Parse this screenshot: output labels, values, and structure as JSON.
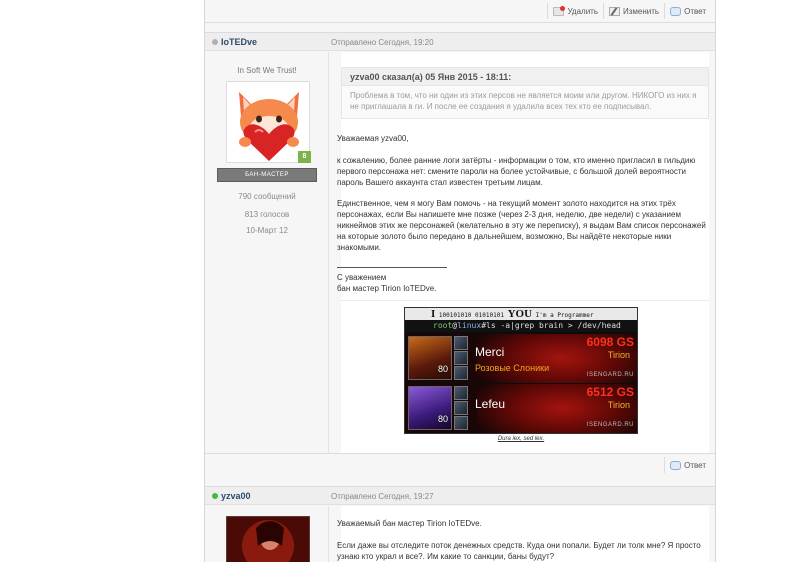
{
  "top_actions": {
    "delete_label": "Удалить",
    "edit_label": "Изменить",
    "reply_label": "Ответ"
  },
  "post1": {
    "author": "IoTEDve",
    "date": "Отправлено Сегодня, 19:20",
    "author_title": "In Soft We Trust!",
    "reputation": "8",
    "group": "БАН-МАСТЕР",
    "posts_count": "790 сообщений",
    "votes": "813 голосов",
    "registered": "10-Март 12",
    "quote": {
      "head": "yzva00 сказал(а) 05 Янв 2015 - 18:11:",
      "body": "Проблема в том, что ни один из этих персов не является  моим или другом. НИКОГО из них я не приглашала в ги. И после ее создания я удалила всех тех кто ее подписывал."
    },
    "greeting": "Уважаемая yzva00,",
    "paragraph1": "к сожалению, более ранние логи затёрты - информации о том, кто именно пригласил в гильдию первого персонажа нет: смените пароли на более устойчивые, с большой долей вероятности пароль Вашего аккаунта стал известен третьим лицам.",
    "paragraph2": "Единственное, чем я могу Вам помочь - на текущий момент золото находится на этих трёх персонажах, если Вы напишете мне позже (через 2-3 дня, неделю, две недели) с указанием никнеймов этих же персонажей (желательно в эту же переписку), я выдам Вам список персонажей на которые золото было передано в дальнейшем, возможно, Вы найдёте некоторые ники знакомыми.",
    "closing1": "С уважением",
    "closing2": "бан мастер Tirion IoTEDve.",
    "reply_label": "Ответ"
  },
  "signature": {
    "top_big_i": "I",
    "top_bits": "100101010 01010101",
    "top_you": "YOU",
    "top_text": "I'm a Programmer",
    "cmd_user": "root",
    "cmd_host": "linux",
    "cmd_rest": "#ls -a|grep brain > /dev/head",
    "characters": [
      {
        "name": "Merci",
        "guild": "Розовые Слоники",
        "gs": "6098 GS",
        "realm": "Tirion",
        "level": "80",
        "site": "ISENGARD.RU"
      },
      {
        "name": "Lefeu",
        "guild": "",
        "gs": "6512 GS",
        "realm": "Tirion",
        "level": "80",
        "site": "ISENGARD.RU"
      }
    ],
    "footnote": "Dura lex, sed lex."
  },
  "post2": {
    "author": "yzva00",
    "date": "Отправлено Сегодня, 19:27",
    "greeting": "Уважаемый бан мастер Tirion IoTEDve.",
    "paragraph1": "Если даже вы отследите поток денежных средств. Куда они попали. Будет ли толк мне? Я просто узнаю кто украл и все?. Им какие то санкции, баны будут?"
  },
  "colors": {
    "online": "#45b842",
    "offline": "#b0b0b0",
    "reputation": "#7fb24a",
    "gearscore": "#ff3020",
    "guild": "#f0a81c"
  }
}
